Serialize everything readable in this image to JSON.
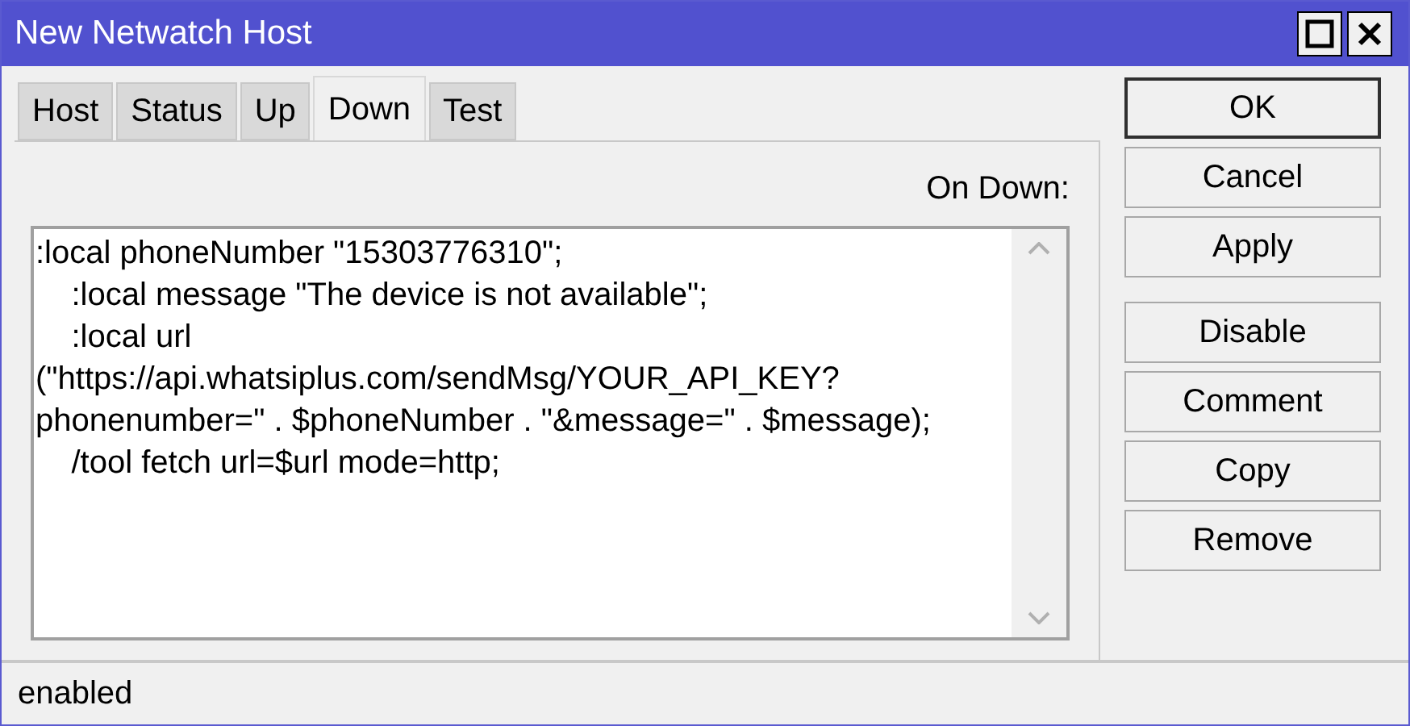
{
  "window": {
    "title": "New Netwatch Host"
  },
  "tabs": [
    {
      "label": "Host",
      "selected": false
    },
    {
      "label": "Status",
      "selected": false
    },
    {
      "label": "Up",
      "selected": false
    },
    {
      "label": "Down",
      "selected": true
    },
    {
      "label": "Test",
      "selected": false
    }
  ],
  "field": {
    "label": "On Down:",
    "value": ":local phoneNumber \"15303776310\";\n    :local message \"The device is not available\";\n    :local url\n(\"https://api.whatsiplus.com/sendMsg/YOUR_API_KEY?\nphonenumber=\" . $phoneNumber . \"&message=\" . $message);\n    /tool fetch url=$url mode=http;"
  },
  "buttons": [
    {
      "label": "OK",
      "default": true
    },
    {
      "label": "Cancel",
      "default": false
    },
    {
      "label": "Apply",
      "default": false
    },
    {
      "label": "Disable",
      "default": false
    },
    {
      "label": "Comment",
      "default": false
    },
    {
      "label": "Copy",
      "default": false
    },
    {
      "label": "Remove",
      "default": false
    }
  ],
  "status_bar": "enabled"
}
